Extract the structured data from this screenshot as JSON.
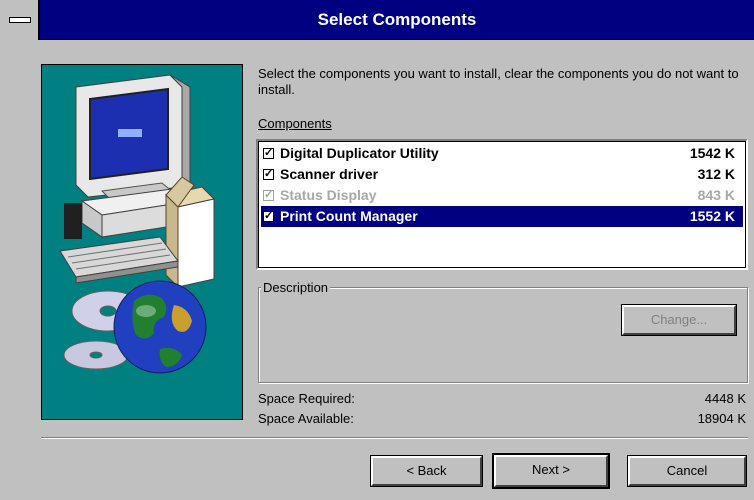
{
  "window": {
    "title": "Select Components"
  },
  "intro_text": "Select the components you want to install, clear the components you do not want to install.",
  "components": {
    "label": "Components",
    "items": [
      {
        "name": "Digital Duplicator Utility",
        "size": "1542 K",
        "checked": true,
        "state": "normal"
      },
      {
        "name": "Scanner driver",
        "size": "312 K",
        "checked": true,
        "state": "normal"
      },
      {
        "name": "Status Display",
        "size": "843 K",
        "checked": true,
        "state": "disabled"
      },
      {
        "name": "Print Count Manager",
        "size": "1552 K",
        "checked": true,
        "state": "selected"
      }
    ]
  },
  "description": {
    "label": "Description",
    "change_button": "Change..."
  },
  "space": {
    "required_label": "Space Required:",
    "required_value": "4448 K",
    "available_label": "Space Available:",
    "available_value": "18904 K"
  },
  "buttons": {
    "back": "< Back",
    "next": "Next >",
    "cancel": "Cancel"
  },
  "colors": {
    "titlebar": "#000080",
    "panel": "#008080",
    "dialog_face": "#c0c0c0",
    "selection": "#000080"
  }
}
